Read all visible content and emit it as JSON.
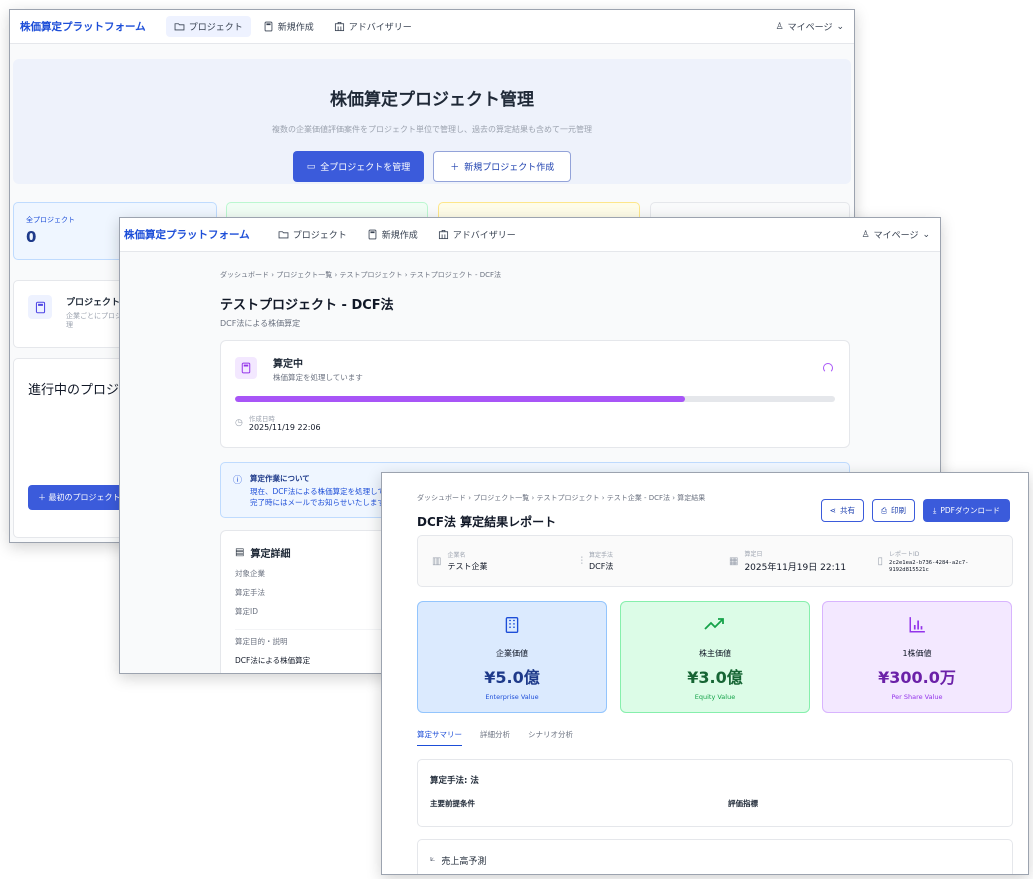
{
  "nav": {
    "brand": "株価算定プラットフォーム",
    "items": [
      {
        "label": "プロジェクト",
        "icon": "folder-icon"
      },
      {
        "label": "新規作成",
        "icon": "calculator-icon"
      },
      {
        "label": "アドバイザリー",
        "icon": "building-icon"
      }
    ],
    "mypage": "マイページ"
  },
  "win1": {
    "hero_title": "株価算定プロジェクト管理",
    "hero_desc": "複数の企業価値評価案件をプロジェクト単位で管理し、過去の算定結果も含めて一元管理",
    "manage_all_label": "全プロジェクトを管理",
    "new_project_label": "新規プロジェクト作成",
    "stats": [
      {
        "label": "全プロジェクト",
        "value": "0"
      }
    ],
    "feature_title": "プロジェクトベ",
    "feature_desc": "企業ごとにプロジ\n理",
    "in_progress_title": "進行中のプロジェ",
    "first_project_label": "＋ 最初のプロジェクトを"
  },
  "win2": {
    "breadcrumb": "ダッシュボード  ›  プロジェクト一覧  ›  テストプロジェクト  ›  テストプロジェクト - DCF法",
    "title": "テストプロジェクト - DCF法",
    "subtitle": "DCF法による株価算定",
    "status_title": "算定中",
    "status_sub": "株価算定を処理しています",
    "progress": 0.75,
    "created_label": "作成日時",
    "created_value": "2025/11/19 22:06",
    "info_title": "算定作業について",
    "info_line1": "現在、DCF法による株価算定を処理していま",
    "info_line2": "完了時にはメールでお知らせいたしますので、",
    "detail_title": "算定詳細",
    "detail_rows": [
      "対象企業",
      "算定手法",
      "算定ID"
    ],
    "purpose_label": "算定目的・説明",
    "purpose_value": "DCF法による株価算定"
  },
  "win3": {
    "breadcrumb": "ダッシュボード  ›  プロジェクト一覧  ›  テストプロジェクト  ›  テスト企業 - DCF法  ›  算定結果",
    "title": "DCF法 算定結果レポート",
    "share_label": "共有",
    "print_label": "印刷",
    "pdf_label": "PDFダウンロード",
    "meta": [
      {
        "label": "企業名",
        "value": "テスト企業",
        "icon": "building-icon"
      },
      {
        "label": "算定手法",
        "value": "DCF法",
        "icon": "bar-chart-icon"
      },
      {
        "label": "算定日",
        "value": "2025年11月19日 22:11",
        "icon": "calendar-icon"
      },
      {
        "label": "レポートID",
        "value": "2c2e1ea2-b736-4284-a2c7-\n9192d815521c",
        "icon": "document-icon"
      }
    ],
    "values": [
      {
        "label": "企業価値",
        "value": "¥5.0億",
        "en": "Enterprise Value",
        "icon": "building-icon",
        "color": "#1e3a8a"
      },
      {
        "label": "株主価値",
        "value": "¥3.0億",
        "en": "Equity Value",
        "icon": "trending-up-icon",
        "color": "#166534"
      },
      {
        "label": "1株価値",
        "value": "¥300.0万",
        "en": "Per Share Value",
        "icon": "bar-chart-icon",
        "color": "#6b21a8"
      }
    ],
    "tabs": [
      "算定サマリー",
      "詳細分析",
      "シナリオ分析"
    ],
    "method_label": "算定手法: 法",
    "assumptions_label": "主要前提条件",
    "metrics_label": "評価指標",
    "sales_label": "売上高予測"
  }
}
